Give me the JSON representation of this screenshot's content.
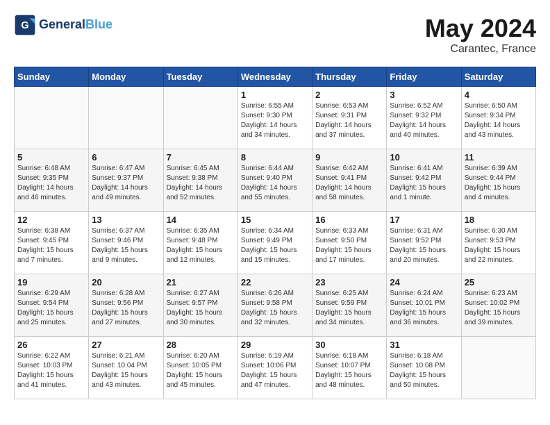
{
  "header": {
    "logo_text_1": "General",
    "logo_text_2": "Blue",
    "month": "May 2024",
    "location": "Carantec, France"
  },
  "weekdays": [
    "Sunday",
    "Monday",
    "Tuesday",
    "Wednesday",
    "Thursday",
    "Friday",
    "Saturday"
  ],
  "weeks": [
    [
      {
        "day": "",
        "sunrise": "",
        "sunset": "",
        "daylight": ""
      },
      {
        "day": "",
        "sunrise": "",
        "sunset": "",
        "daylight": ""
      },
      {
        "day": "",
        "sunrise": "",
        "sunset": "",
        "daylight": ""
      },
      {
        "day": "1",
        "sunrise": "Sunrise: 6:55 AM",
        "sunset": "Sunset: 9:30 PM",
        "daylight": "Daylight: 14 hours and 34 minutes."
      },
      {
        "day": "2",
        "sunrise": "Sunrise: 6:53 AM",
        "sunset": "Sunset: 9:31 PM",
        "daylight": "Daylight: 14 hours and 37 minutes."
      },
      {
        "day": "3",
        "sunrise": "Sunrise: 6:52 AM",
        "sunset": "Sunset: 9:32 PM",
        "daylight": "Daylight: 14 hours and 40 minutes."
      },
      {
        "day": "4",
        "sunrise": "Sunrise: 6:50 AM",
        "sunset": "Sunset: 9:34 PM",
        "daylight": "Daylight: 14 hours and 43 minutes."
      }
    ],
    [
      {
        "day": "5",
        "sunrise": "Sunrise: 6:48 AM",
        "sunset": "Sunset: 9:35 PM",
        "daylight": "Daylight: 14 hours and 46 minutes."
      },
      {
        "day": "6",
        "sunrise": "Sunrise: 6:47 AM",
        "sunset": "Sunset: 9:37 PM",
        "daylight": "Daylight: 14 hours and 49 minutes."
      },
      {
        "day": "7",
        "sunrise": "Sunrise: 6:45 AM",
        "sunset": "Sunset: 9:38 PM",
        "daylight": "Daylight: 14 hours and 52 minutes."
      },
      {
        "day": "8",
        "sunrise": "Sunrise: 6:44 AM",
        "sunset": "Sunset: 9:40 PM",
        "daylight": "Daylight: 14 hours and 55 minutes."
      },
      {
        "day": "9",
        "sunrise": "Sunrise: 6:42 AM",
        "sunset": "Sunset: 9:41 PM",
        "daylight": "Daylight: 14 hours and 58 minutes."
      },
      {
        "day": "10",
        "sunrise": "Sunrise: 6:41 AM",
        "sunset": "Sunset: 9:42 PM",
        "daylight": "Daylight: 15 hours and 1 minute."
      },
      {
        "day": "11",
        "sunrise": "Sunrise: 6:39 AM",
        "sunset": "Sunset: 9:44 PM",
        "daylight": "Daylight: 15 hours and 4 minutes."
      }
    ],
    [
      {
        "day": "12",
        "sunrise": "Sunrise: 6:38 AM",
        "sunset": "Sunset: 9:45 PM",
        "daylight": "Daylight: 15 hours and 7 minutes."
      },
      {
        "day": "13",
        "sunrise": "Sunrise: 6:37 AM",
        "sunset": "Sunset: 9:46 PM",
        "daylight": "Daylight: 15 hours and 9 minutes."
      },
      {
        "day": "14",
        "sunrise": "Sunrise: 6:35 AM",
        "sunset": "Sunset: 9:48 PM",
        "daylight": "Daylight: 15 hours and 12 minutes."
      },
      {
        "day": "15",
        "sunrise": "Sunrise: 6:34 AM",
        "sunset": "Sunset: 9:49 PM",
        "daylight": "Daylight: 15 hours and 15 minutes."
      },
      {
        "day": "16",
        "sunrise": "Sunrise: 6:33 AM",
        "sunset": "Sunset: 9:50 PM",
        "daylight": "Daylight: 15 hours and 17 minutes."
      },
      {
        "day": "17",
        "sunrise": "Sunrise: 6:31 AM",
        "sunset": "Sunset: 9:52 PM",
        "daylight": "Daylight: 15 hours and 20 minutes."
      },
      {
        "day": "18",
        "sunrise": "Sunrise: 6:30 AM",
        "sunset": "Sunset: 9:53 PM",
        "daylight": "Daylight: 15 hours and 22 minutes."
      }
    ],
    [
      {
        "day": "19",
        "sunrise": "Sunrise: 6:29 AM",
        "sunset": "Sunset: 9:54 PM",
        "daylight": "Daylight: 15 hours and 25 minutes."
      },
      {
        "day": "20",
        "sunrise": "Sunrise: 6:28 AM",
        "sunset": "Sunset: 9:56 PM",
        "daylight": "Daylight: 15 hours and 27 minutes."
      },
      {
        "day": "21",
        "sunrise": "Sunrise: 6:27 AM",
        "sunset": "Sunset: 9:57 PM",
        "daylight": "Daylight: 15 hours and 30 minutes."
      },
      {
        "day": "22",
        "sunrise": "Sunrise: 6:26 AM",
        "sunset": "Sunset: 9:58 PM",
        "daylight": "Daylight: 15 hours and 32 minutes."
      },
      {
        "day": "23",
        "sunrise": "Sunrise: 6:25 AM",
        "sunset": "Sunset: 9:59 PM",
        "daylight": "Daylight: 15 hours and 34 minutes."
      },
      {
        "day": "24",
        "sunrise": "Sunrise: 6:24 AM",
        "sunset": "Sunset: 10:01 PM",
        "daylight": "Daylight: 15 hours and 36 minutes."
      },
      {
        "day": "25",
        "sunrise": "Sunrise: 6:23 AM",
        "sunset": "Sunset: 10:02 PM",
        "daylight": "Daylight: 15 hours and 39 minutes."
      }
    ],
    [
      {
        "day": "26",
        "sunrise": "Sunrise: 6:22 AM",
        "sunset": "Sunset: 10:03 PM",
        "daylight": "Daylight: 15 hours and 41 minutes."
      },
      {
        "day": "27",
        "sunrise": "Sunrise: 6:21 AM",
        "sunset": "Sunset: 10:04 PM",
        "daylight": "Daylight: 15 hours and 43 minutes."
      },
      {
        "day": "28",
        "sunrise": "Sunrise: 6:20 AM",
        "sunset": "Sunset: 10:05 PM",
        "daylight": "Daylight: 15 hours and 45 minutes."
      },
      {
        "day": "29",
        "sunrise": "Sunrise: 6:19 AM",
        "sunset": "Sunset: 10:06 PM",
        "daylight": "Daylight: 15 hours and 47 minutes."
      },
      {
        "day": "30",
        "sunrise": "Sunrise: 6:18 AM",
        "sunset": "Sunset: 10:07 PM",
        "daylight": "Daylight: 15 hours and 48 minutes."
      },
      {
        "day": "31",
        "sunrise": "Sunrise: 6:18 AM",
        "sunset": "Sunset: 10:08 PM",
        "daylight": "Daylight: 15 hours and 50 minutes."
      },
      {
        "day": "",
        "sunrise": "",
        "sunset": "",
        "daylight": ""
      }
    ]
  ]
}
